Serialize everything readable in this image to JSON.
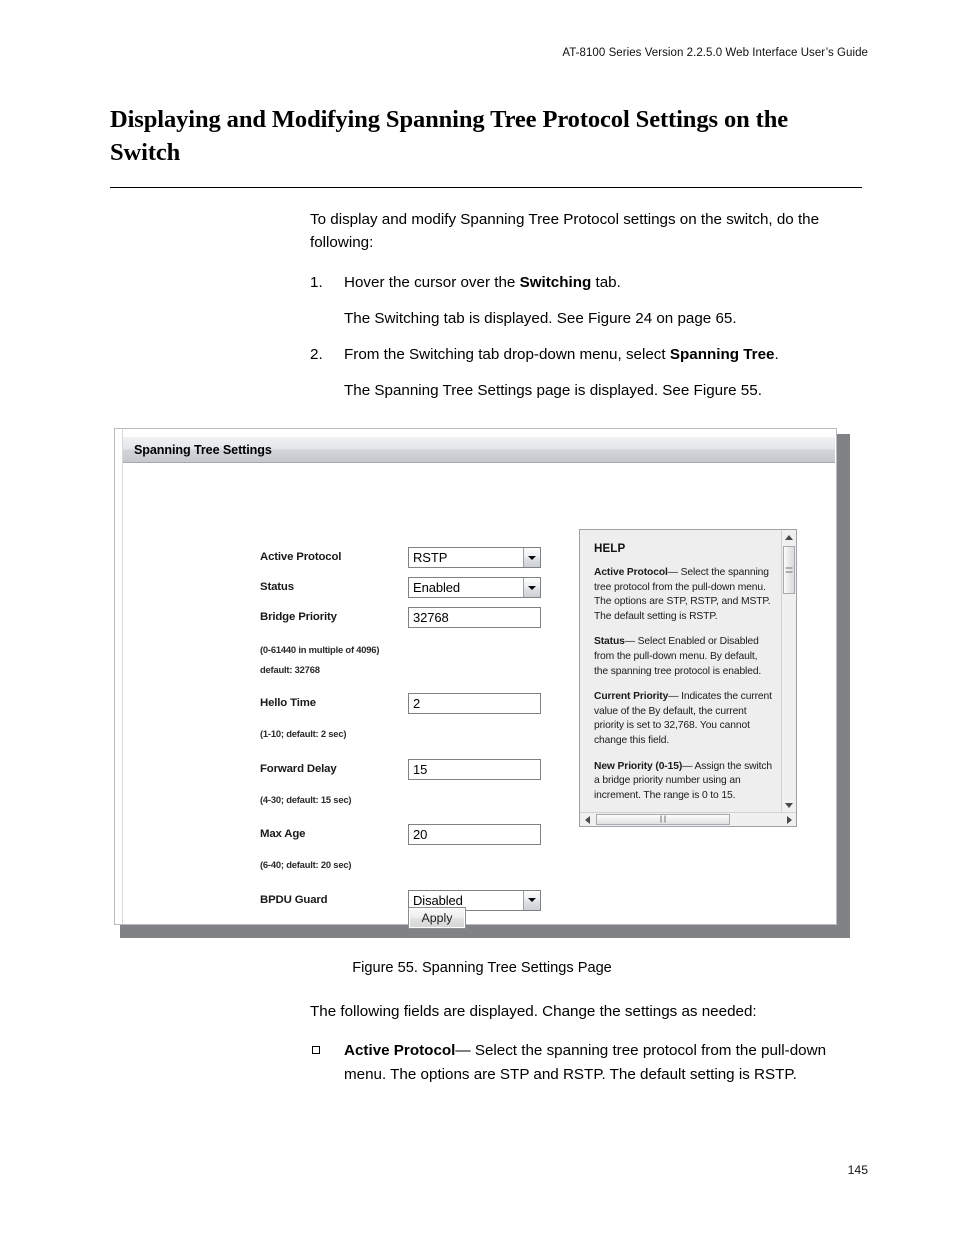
{
  "document": {
    "running_header": "AT-8100 Series Version 2.2.5.0 Web Interface User’s Guide",
    "page_number": "145",
    "heading": "Displaying and Modifying Spanning Tree Protocol Settings on the Switch"
  },
  "intro": {
    "paragraph": "To display and modify Spanning Tree Protocol settings on the switch, do the following:"
  },
  "steps": [
    {
      "number": "1.",
      "text_pre": "Hover the cursor over the ",
      "text_bold": "Switching",
      "text_post": " tab.",
      "sub": "The Switching tab is displayed. See Figure 24 on page 65."
    },
    {
      "number": "2.",
      "text_pre": "From the Switching tab drop-down menu, select ",
      "text_bold": "Spanning Tree",
      "text_post": ".",
      "sub": "The Spanning Tree Settings page is displayed. See Figure 55."
    }
  ],
  "figure": {
    "caption": "Figure 55. Spanning Tree Settings Page",
    "window_title": "Spanning Tree Settings",
    "form": {
      "fields": [
        {
          "label": "Active Protocol",
          "type": "select",
          "value": "RSTP",
          "options": [
            "STP",
            "RSTP",
            "MSTP"
          ],
          "hints": []
        },
        {
          "label": "Status",
          "type": "select",
          "value": "Enabled",
          "options": [
            "Enabled",
            "Disabled"
          ],
          "hints": []
        },
        {
          "label": "Bridge Priority",
          "type": "text",
          "value": "32768",
          "hints": [
            "(0-61440 in multiple of 4096)",
            "default: 32768"
          ]
        },
        {
          "label": "Hello Time",
          "type": "text",
          "value": "2",
          "hints": [
            "(1-10; default: 2 sec)"
          ]
        },
        {
          "label": "Forward Delay",
          "type": "text",
          "value": "15",
          "hints": [
            "(4-30; default: 15 sec)"
          ]
        },
        {
          "label": "Max Age",
          "type": "text",
          "value": "20",
          "hints": [
            "(6-40; default: 20 sec)"
          ]
        },
        {
          "label": "BPDU Guard",
          "type": "select",
          "value": "Disabled",
          "options": [
            "Enabled",
            "Disabled"
          ],
          "hints": []
        }
      ],
      "apply_label": "Apply"
    },
    "help": {
      "title": "HELP",
      "entries": [
        {
          "term": "Active Protocol",
          "body": "— Select the spanning tree protocol from the pull-down menu. The options are STP, RSTP, and MSTP. The default setting is RSTP."
        },
        {
          "term": "Status",
          "body": "— Select Enabled or Disabled from the pull-down menu. By default, the spanning tree protocol is enabled."
        },
        {
          "term": "Current Priority",
          "body": "— Indicates the current value of the By default, the current priority is set to 32,768. You cannot change this field."
        },
        {
          "term": "New Priority (0-15)",
          "body": "— Assign the switch a bridge priority number using an increment. The range is 0 to 15."
        }
      ]
    }
  },
  "after_figure": {
    "paragraph": "The following fields are displayed. Change the settings as needed:",
    "bullets": [
      {
        "term": "Active Protocol",
        "body": "— Select the spanning tree protocol from the pull-down menu. The options are STP and RSTP. The default setting is RSTP."
      }
    ]
  }
}
